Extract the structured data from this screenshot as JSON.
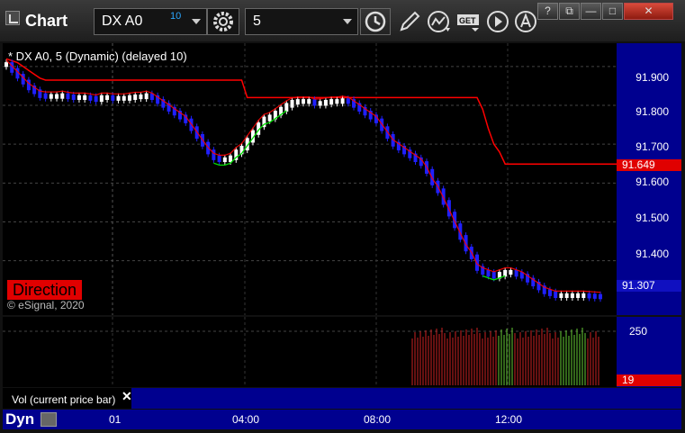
{
  "window": {
    "title": "Chart",
    "symbol": "DX A0",
    "symbol_superscript": "10",
    "interval": "5",
    "buttons": {
      "help": "?",
      "restore": "⧉",
      "minimize": "—",
      "maximize": "□",
      "close": "✕"
    }
  },
  "toolbar_icons": [
    "gear-icon",
    "clock-icon",
    "pencil-icon",
    "line-study-icon",
    "get-icon",
    "play-icon",
    "alert-icon"
  ],
  "price_pane": {
    "study_title": "* DX A0, 5 (Dynamic) (delayed 10)",
    "direction_label": "Direction",
    "copyright": "© eSignal, 2020",
    "axis_labels": [
      "91.900",
      "91.800",
      "91.700",
      "91.600",
      "91.500",
      "91.400"
    ],
    "last_price_tag": "91.307",
    "red_line_tag": "91.649"
  },
  "volume_pane": {
    "title": "Vol (current price bar)",
    "close_symbol": "✕",
    "axis_label": "250",
    "current_tag": "19"
  },
  "time_axis": {
    "dyn_label": "Dyn",
    "labels": [
      "01",
      "04:00",
      "08:00",
      "12:00"
    ]
  },
  "colors": {
    "axis_bg": "#00008f",
    "red_line": "#ff0000",
    "green_line": "#00dd00",
    "candle_up": "#ffffff",
    "candle_down": "#2020ff",
    "vol_up": "#66cc33",
    "vol_down": "#cc2222"
  },
  "chart_data": {
    "type": "line",
    "ylim": [
      91.26,
      91.96
    ],
    "ticks": [
      91.9,
      91.8,
      91.7,
      91.6,
      91.5,
      91.4
    ],
    "time_ticks": [
      "01",
      "04:00",
      "08:00",
      "12:00"
    ],
    "series": [
      {
        "values": [
          91.905,
          91.89,
          91.875,
          91.86,
          91.845,
          91.835,
          91.825,
          91.823,
          91.823,
          91.823,
          91.825,
          91.822,
          91.82,
          91.82,
          91.82,
          91.818,
          91.815,
          91.82,
          91.82,
          91.818,
          91.818,
          91.818,
          91.82,
          91.822,
          91.822,
          91.825,
          91.82,
          91.81,
          91.8,
          91.79,
          91.78,
          91.77,
          91.76,
          91.74,
          91.72,
          91.7,
          91.68,
          91.665,
          91.66,
          91.66,
          91.665,
          91.68,
          91.69,
          91.71,
          91.73,
          91.75,
          91.765,
          91.77,
          91.78,
          91.79,
          91.8,
          91.808,
          91.81,
          91.81,
          91.81,
          91.805,
          91.805,
          91.808,
          91.81,
          91.81,
          91.812,
          91.81,
          91.8,
          91.79,
          91.78,
          91.77,
          91.76,
          91.74,
          91.72,
          91.7,
          91.69,
          91.68,
          91.67,
          91.66,
          91.65,
          91.63,
          91.6,
          91.58,
          91.55,
          91.52,
          91.49,
          91.46,
          91.43,
          91.41,
          91.38,
          91.37,
          91.365,
          91.36,
          91.365,
          91.37,
          91.37,
          91.365,
          91.36,
          91.35,
          91.34,
          91.33,
          91.32,
          91.315,
          91.31,
          91.31,
          91.31,
          91.31,
          91.31,
          91.31,
          91.309,
          91.308,
          91.307
        ]
      },
      {
        "values": [
          91.92,
          91.915,
          91.91,
          91.9,
          91.89,
          91.88,
          91.87,
          91.865,
          91.865,
          91.865,
          91.865,
          91.865,
          91.865,
          91.865,
          91.865,
          91.865,
          91.865,
          91.865,
          91.865,
          91.865,
          91.865,
          91.865,
          91.865,
          91.865,
          91.865,
          91.865,
          91.865,
          91.865,
          91.865,
          91.865,
          91.865,
          91.865,
          91.865,
          91.865,
          91.865,
          91.865,
          91.865,
          91.865,
          91.865,
          91.865,
          91.865,
          91.865,
          91.865,
          91.82,
          91.82,
          91.82,
          91.82,
          91.82,
          91.82,
          91.82,
          91.82,
          91.82,
          91.82,
          91.82,
          91.82,
          91.82,
          91.82,
          91.82,
          91.82,
          91.82,
          91.82,
          91.82,
          91.82,
          91.82,
          91.82,
          91.82,
          91.82,
          91.82,
          91.82,
          91.82,
          91.82,
          91.82,
          91.82,
          91.82,
          91.82,
          91.82,
          91.82,
          91.82,
          91.82,
          91.82,
          91.82,
          91.82,
          91.82,
          91.82,
          91.82,
          91.79,
          91.74,
          91.7,
          91.68,
          91.649,
          91.649,
          91.649,
          91.649,
          91.649,
          91.649,
          91.649,
          91.649,
          91.649,
          91.649,
          91.649,
          91.649,
          91.649,
          91.649,
          91.649,
          91.649,
          91.649,
          91.649
        ]
      }
    ]
  }
}
